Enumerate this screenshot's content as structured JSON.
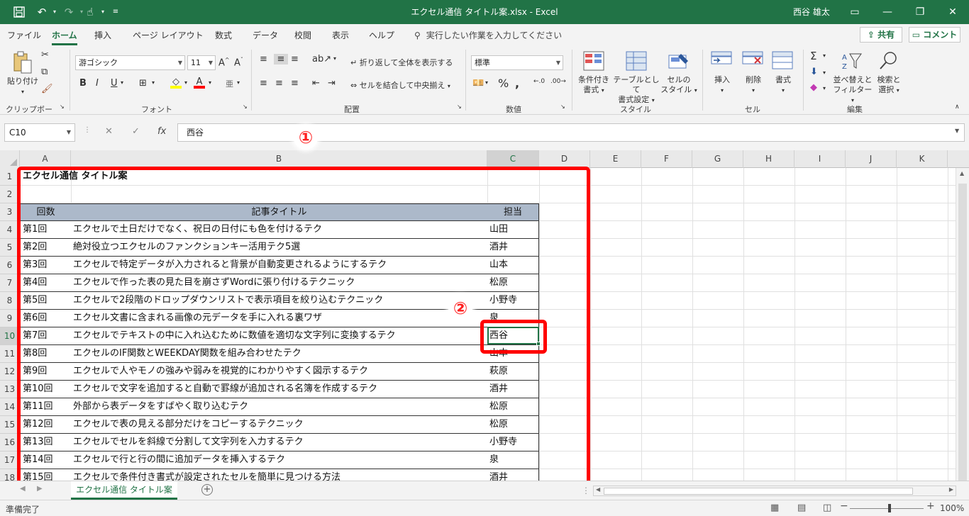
{
  "titlebar": {
    "title": "エクセル通信 タイトル案.xlsx  -  Excel",
    "user": "西谷 雄太",
    "colors": {
      "brand": "#217346"
    }
  },
  "menu": {
    "tabs": [
      "ファイル",
      "ホーム",
      "挿入",
      "ページ レイアウト",
      "数式",
      "データ",
      "校閲",
      "表示",
      "ヘルプ"
    ],
    "active_tab": "ホーム",
    "tell_me": "実行したい作業を入力してください",
    "share": "共有",
    "comment": "コメント"
  },
  "ribbon": {
    "clipboard": {
      "paste": "貼り付け",
      "label": "クリップボード"
    },
    "font": {
      "name": "游ゴシック",
      "size": "11",
      "bold": "B",
      "italic": "I",
      "underline": "U",
      "label": "フォント"
    },
    "alignment": {
      "wrap": "折り返して全体を表示する",
      "merge": "セルを結合して中央揃え",
      "label": "配置"
    },
    "number": {
      "format": "標準",
      "label": "数値"
    },
    "styles": {
      "conditional": [
        "条件付き",
        "書式"
      ],
      "table": [
        "テーブルとして",
        "書式設定"
      ],
      "cell": [
        "セルの",
        "スタイル"
      ],
      "label": "スタイル"
    },
    "cells": {
      "insert": "挿入",
      "delete": "削除",
      "format": "書式",
      "label": "セル"
    },
    "editing": {
      "sort": [
        "並べ替えと",
        "フィルター"
      ],
      "find": [
        "検索と",
        "選択"
      ],
      "label": "編集"
    }
  },
  "formula_bar": {
    "name_box": "C10",
    "fx": "fx",
    "value": "西谷"
  },
  "grid": {
    "columns": [
      "A",
      "B",
      "C",
      "D",
      "E",
      "F",
      "G",
      "H",
      "I",
      "J",
      "K"
    ],
    "rows": [
      "1",
      "2",
      "3",
      "4",
      "5",
      "6",
      "7",
      "8",
      "9",
      "10",
      "11",
      "12",
      "13",
      "14",
      "15",
      "16",
      "17",
      "18"
    ],
    "selected_column": "C",
    "selected_row": "10",
    "title": "エクセル通信 タイトル案",
    "headers": [
      "回数",
      "記事タイトル",
      "担当"
    ],
    "data": [
      [
        "第1回",
        "エクセルで土日だけでなく、祝日の日付にも色を付けるテク",
        "山田"
      ],
      [
        "第2回",
        "絶対役立つエクセルのファンクションキー活用テク5選",
        "酒井"
      ],
      [
        "第3回",
        "エクセルで特定データが入力されると背景が自動変更されるようにするテク",
        "山本"
      ],
      [
        "第4回",
        "エクセルで作った表の見た目を崩さずWordに張り付けるテクニック",
        "松原"
      ],
      [
        "第5回",
        "エクセルで2段階のドロップダウンリストで表示項目を絞り込むテクニック",
        "小野寺"
      ],
      [
        "第6回",
        "エクセル文書に含まれる画像の元データを手に入れる裏ワザ",
        "泉"
      ],
      [
        "第7回",
        "エクセルでテキストの中に入れ込むために数値を適切な文字列に変換するテク",
        "西谷"
      ],
      [
        "第8回",
        "エクセルのIF関数とWEEKDAY関数を組み合わせたテク",
        "山本"
      ],
      [
        "第9回",
        "エクセルで人やモノの強みや弱みを視覚的にわかりやすく図示するテク",
        "萩原"
      ],
      [
        "第10回",
        "エクセルで文字を追加すると自動で罫線が追加される名簿を作成するテク",
        "酒井"
      ],
      [
        "第11回",
        "外部から表データをすばやく取り込むテク",
        "松原"
      ],
      [
        "第12回",
        "エクセルで表の見える部分だけをコピーするテクニック",
        "松原"
      ],
      [
        "第13回",
        "エクセルでセルを斜線で分割して文字列を入力するテク",
        "小野寺"
      ],
      [
        "第14回",
        "エクセルで行と行の間に追加データを挿入するテク",
        "泉"
      ],
      [
        "第15回",
        "エクセルで条件付き書式が設定されたセルを簡単に見つける方法",
        "酒井"
      ]
    ]
  },
  "annotations": {
    "one": "①",
    "two": "②",
    "color": "#ff0000"
  },
  "sheet": {
    "tab": "エクセル通信 タイトル案"
  },
  "status": {
    "ready": "準備完了",
    "zoom": "100%"
  }
}
